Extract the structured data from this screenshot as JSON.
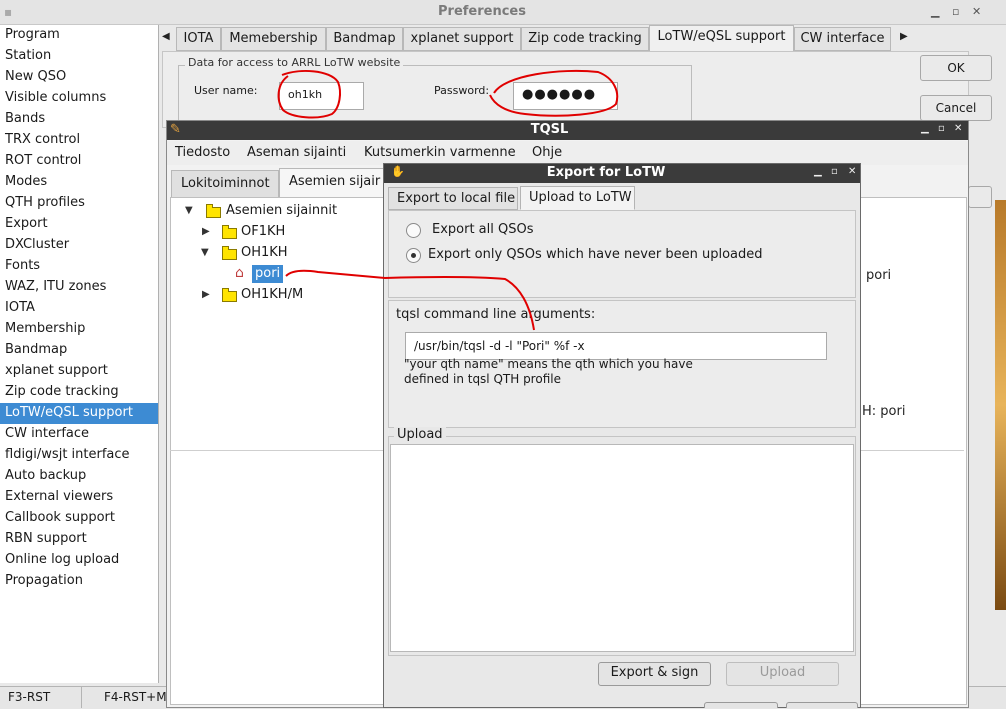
{
  "preferences": {
    "title": "Preferences",
    "sidebar": [
      "Program",
      "Station",
      "New QSO",
      "Visible columns",
      "Bands",
      "TRX control",
      "ROT control",
      "Modes",
      "QTH profiles",
      "Export",
      "DXCluster",
      "Fonts",
      "WAZ, ITU zones",
      "IOTA",
      "Membership",
      "Bandmap",
      "xplanet support",
      "Zip code tracking",
      "LoTW/eQSL support",
      "CW interface",
      "fldigi/wsjt interface",
      "Auto backup",
      "External viewers",
      "Callbook support",
      "RBN support",
      "Online log upload",
      "Propagation"
    ],
    "selected_sidebar": "LoTW/eQSL support",
    "tabs": [
      "IOTA",
      "Memebership",
      "Bandmap",
      "xplanet support",
      "Zip code tracking",
      "LoTW/eQSL support",
      "CW interface"
    ],
    "active_tab": "LoTW/eQSL support",
    "lotw_group_label": "Data for access to ARRL LoTW website",
    "username_label": "User name:",
    "username_value": "oh1kh",
    "password_label": "Password:",
    "password_value": "●●●●●●",
    "ok_label": "OK",
    "cancel_label": "Cancel"
  },
  "status_bar": [
    "F3-RST",
    "F4-RST+M"
  ],
  "tqsl": {
    "title": "TQSL",
    "menu": [
      "Tiedosto",
      "Aseman sijainti",
      "Kutsumerkin varmenne",
      "Ohje"
    ],
    "tabs": [
      "Lokitoiminnot",
      "Asemien sijair"
    ],
    "tree": {
      "root": "Asemien sijainnit",
      "items": [
        "OF1KH",
        "OH1KH",
        "OH1KH/M"
      ],
      "child": "pori"
    },
    "behind_text_1": "pori",
    "behind_text_2": "H: pori"
  },
  "export_dialog": {
    "title": "Export for LoTW",
    "tabs": [
      "Export to local file",
      "Upload to LoTW"
    ],
    "radio_all": "Export all QSOs",
    "radio_new": "Export only QSOs which have never been uploaded",
    "args_label": "tqsl command line arguments:",
    "args_value": "/usr/bin/tqsl -d -l \"Pori\" %f -x",
    "hint_line1": "\"your qth name\" means the qth which you have",
    "hint_line2": "defined in tqsl QTH profile",
    "upload_group": "Upload",
    "export_sign_label": "Export & sign",
    "upload_label": "Upload"
  },
  "annotation_color": "#e00000"
}
